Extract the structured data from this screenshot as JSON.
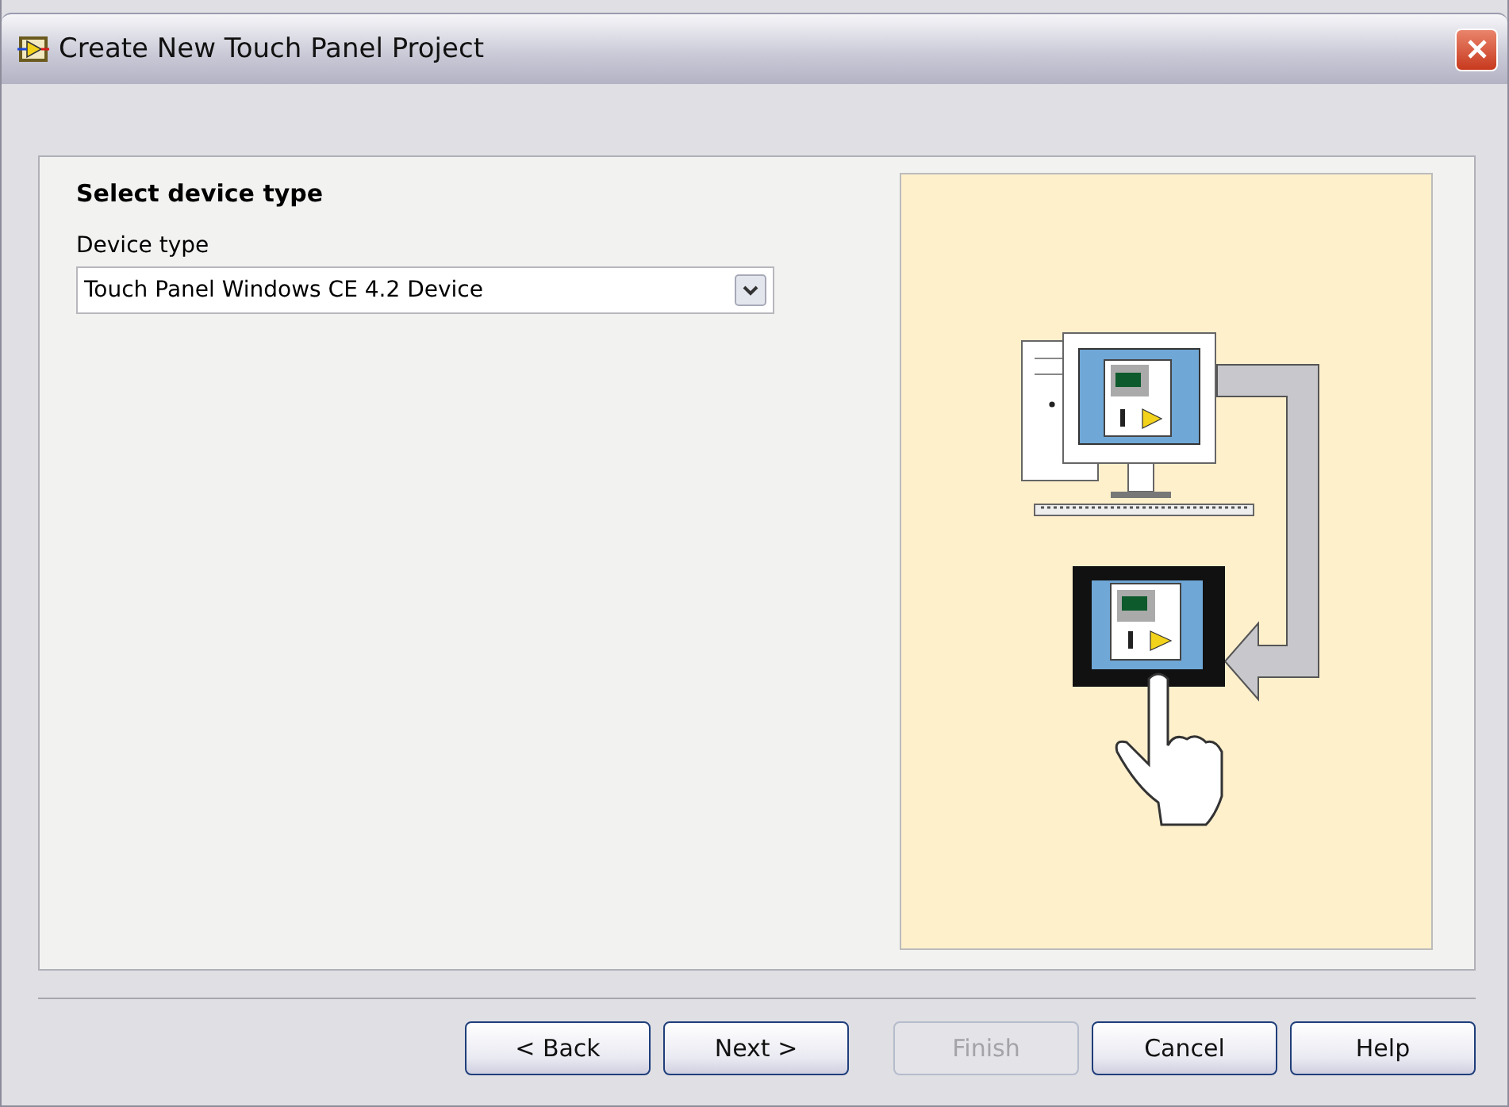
{
  "window": {
    "title": "Create New Touch Panel Project"
  },
  "page": {
    "heading": "Select device type",
    "field_label": "Device type",
    "device_type": {
      "value": "Touch Panel Windows CE 4.2 Device"
    }
  },
  "buttons": [
    {
      "label": "< Back",
      "disabled": false
    },
    {
      "label": "Next >",
      "disabled": false
    },
    {
      "label": "Finish",
      "disabled": true
    },
    {
      "label": "Cancel",
      "disabled": false
    },
    {
      "label": "Help",
      "disabled": false
    }
  ]
}
